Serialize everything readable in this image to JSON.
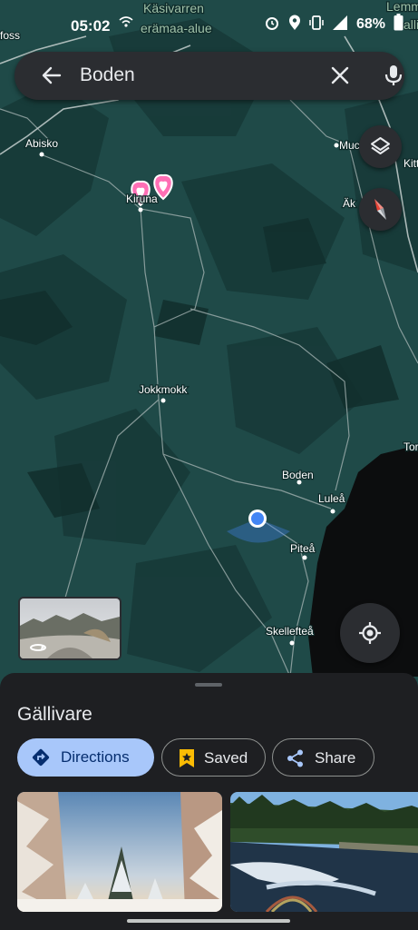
{
  "status": {
    "time": "05:02",
    "battery": "68%"
  },
  "search": {
    "query": "Boden"
  },
  "map": {
    "labels": {
      "kasivarren": "Käsivarren",
      "eramaa": "erämaa-alue",
      "lemme": "Lemme",
      "salli": "salli",
      "foss": "foss",
      "abisko": "Abisko",
      "muc": "Muc",
      "kitt": "Kitt",
      "aka": "Äk",
      "kiruna": "Kiruna",
      "jokkmokk": "Jokkmokk",
      "boden": "Boden",
      "lulea": "Luleå",
      "pitea": "Piteå",
      "tor": "Tor",
      "skelleftea": "Skellefteå"
    }
  },
  "sheet": {
    "title": "Gällivare",
    "directions_label": "Directions",
    "saved_label": "Saved",
    "share_label": "Share"
  },
  "colors": {
    "map_base": "#1f4a48",
    "chip_primary": "#a8c7fa",
    "pin": "#ff6fb5",
    "location_dot": "#4285f4"
  }
}
